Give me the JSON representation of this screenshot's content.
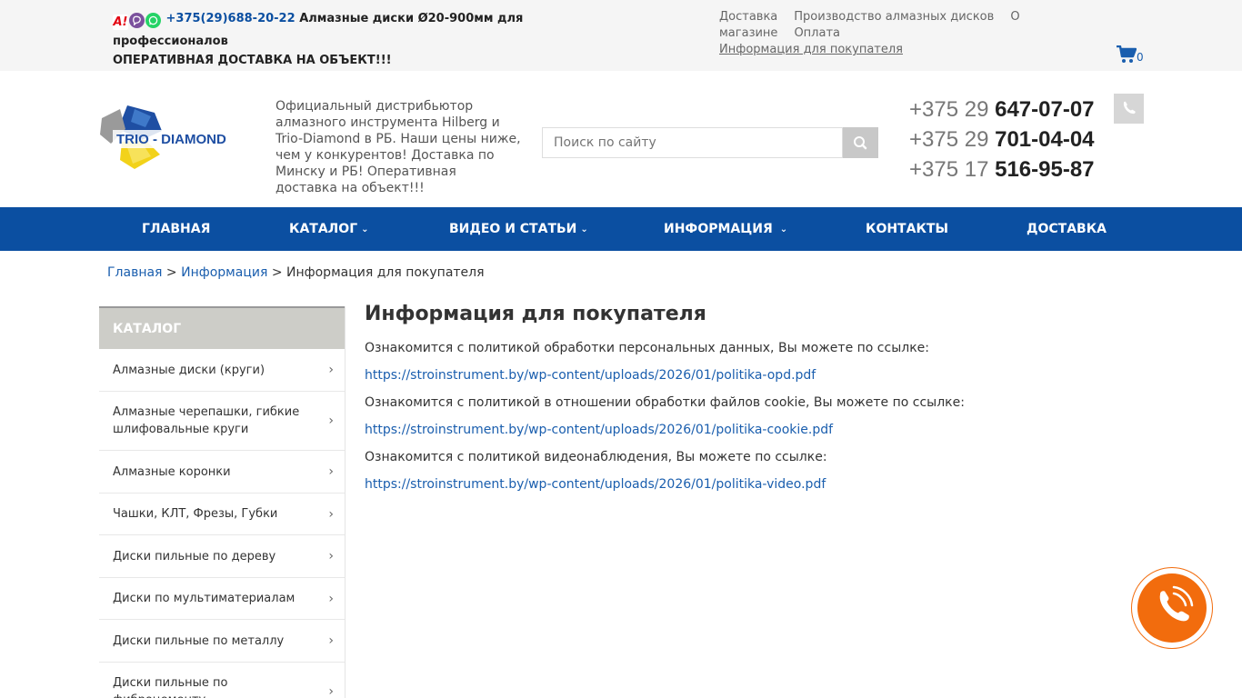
{
  "topbar": {
    "icons": [
      "a1-icon",
      "viber-icon",
      "whatsapp-icon"
    ],
    "phone": "+375(29)688-20-22",
    "promo": "Алмазные диски Ø20-900мм для профессионалов",
    "delivery_note": "ОПЕРАТИВНАЯ ДОСТАВКА НА ОБЪЕКТ!!!",
    "links": [
      "Доставка",
      "Производство алмазных дисков",
      "О магазине",
      "Оплата",
      "Информация для покупателя"
    ],
    "cart_count": "0"
  },
  "header": {
    "logo_text": "TRIO - DIAMOND",
    "tagline": "Официальный дистрибьютор алмазного инструмента Hilberg и Trio-Diamond в РБ. Наши цены ниже, чем у конкурентов! Доставка по Минску и РБ! Оперативная доставка на объект!!!",
    "search_placeholder": "Поиск по сайту",
    "phones": [
      {
        "prefix": "+375 29 ",
        "number": "647-07-07"
      },
      {
        "prefix": "+375 29 ",
        "number": "701-04-04"
      },
      {
        "prefix": "+375 17 ",
        "number": "516-95-87"
      }
    ]
  },
  "nav": {
    "items": [
      "ГЛАВНАЯ",
      "КАТАЛОГ",
      "ВИДЕО И СТАТЬИ",
      "ИНФОРМАЦИЯ",
      "КОНТАКТЫ",
      "ДОСТАВКА"
    ]
  },
  "breadcrumb": {
    "home": "Главная",
    "sep": " > ",
    "section": "Информация",
    "current": "Информация для покупателя"
  },
  "sidebar": {
    "title": "КАТАЛОГ",
    "items": [
      "Алмазные диски (круги)",
      "Алмазные черепашки, гибкие шлифовальные круги",
      "Алмазные коронки",
      "Чашки, КЛТ, Фрезы, Губки",
      "Диски пильные по дереву",
      "Диски по мультиматериалам",
      "Диски пильные по металлу",
      "Диски пильные по фиброцементу"
    ]
  },
  "content": {
    "title": "Информация для покупателя",
    "p1": "Ознакомится с политикой обработки персональных данных, Вы можете по ссылке:",
    "l1": "https://stroinstrument.by/wp-content/uploads/2026/01/politika-opd.pdf",
    "p2": "Ознакомится с политикой в отношении обработки файлов cookie, Вы можете по ссылке:",
    "l2": "https://stroinstrument.by/wp-content/uploads/2026/01/politika-cookie.pdf",
    "p3": "Ознакомится с политикой видеонаблюдения, Вы можете по ссылке:",
    "l3": "https://stroinstrument.by/wp-content/uploads/2026/01/politika-video.pdf"
  },
  "colors": {
    "nav_bg": "#0b4fa1",
    "link": "#1a5eae",
    "callback": "#f26c0d"
  }
}
